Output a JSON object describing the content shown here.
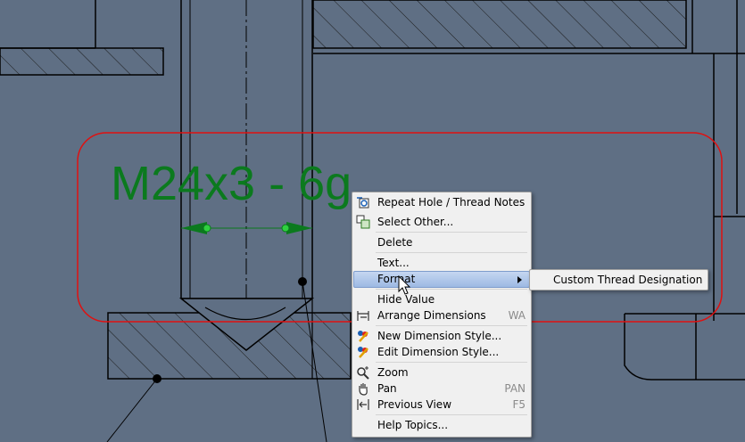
{
  "drawing": {
    "thread_note": "M24x3 - 6g"
  },
  "context_menu": {
    "items": [
      {
        "label": "Repeat Hole / Thread Notes",
        "icon": "repeat-notes-icon"
      },
      {
        "label": "Select Other...",
        "icon": "select-other-icon"
      },
      {
        "label": "Delete"
      },
      {
        "label": "Text..."
      },
      {
        "label": "Format",
        "has_submenu": true,
        "highlighted": true
      },
      {
        "label": "Hide Value"
      },
      {
        "label": "Arrange Dimensions",
        "shortcut": "WA",
        "icon": "arrange-dimensions-icon"
      },
      {
        "label": "New Dimension Style...",
        "icon": "new-dimension-style-icon"
      },
      {
        "label": "Edit Dimension Style...",
        "icon": "edit-dimension-style-icon"
      },
      {
        "label": "Zoom",
        "icon": "zoom-icon"
      },
      {
        "label": "Pan",
        "shortcut": "PAN",
        "icon": "pan-icon"
      },
      {
        "label": "Previous View",
        "shortcut": "F5",
        "icon": "previous-view-icon"
      },
      {
        "label": "Help Topics..."
      }
    ]
  },
  "submenu": {
    "items": [
      {
        "label": "Custom Thread Designation"
      }
    ]
  },
  "colors": {
    "background": "#5f6f84",
    "lines": "#000000",
    "note_text": "#0b7a1e",
    "selection_outline": "#e01010"
  }
}
